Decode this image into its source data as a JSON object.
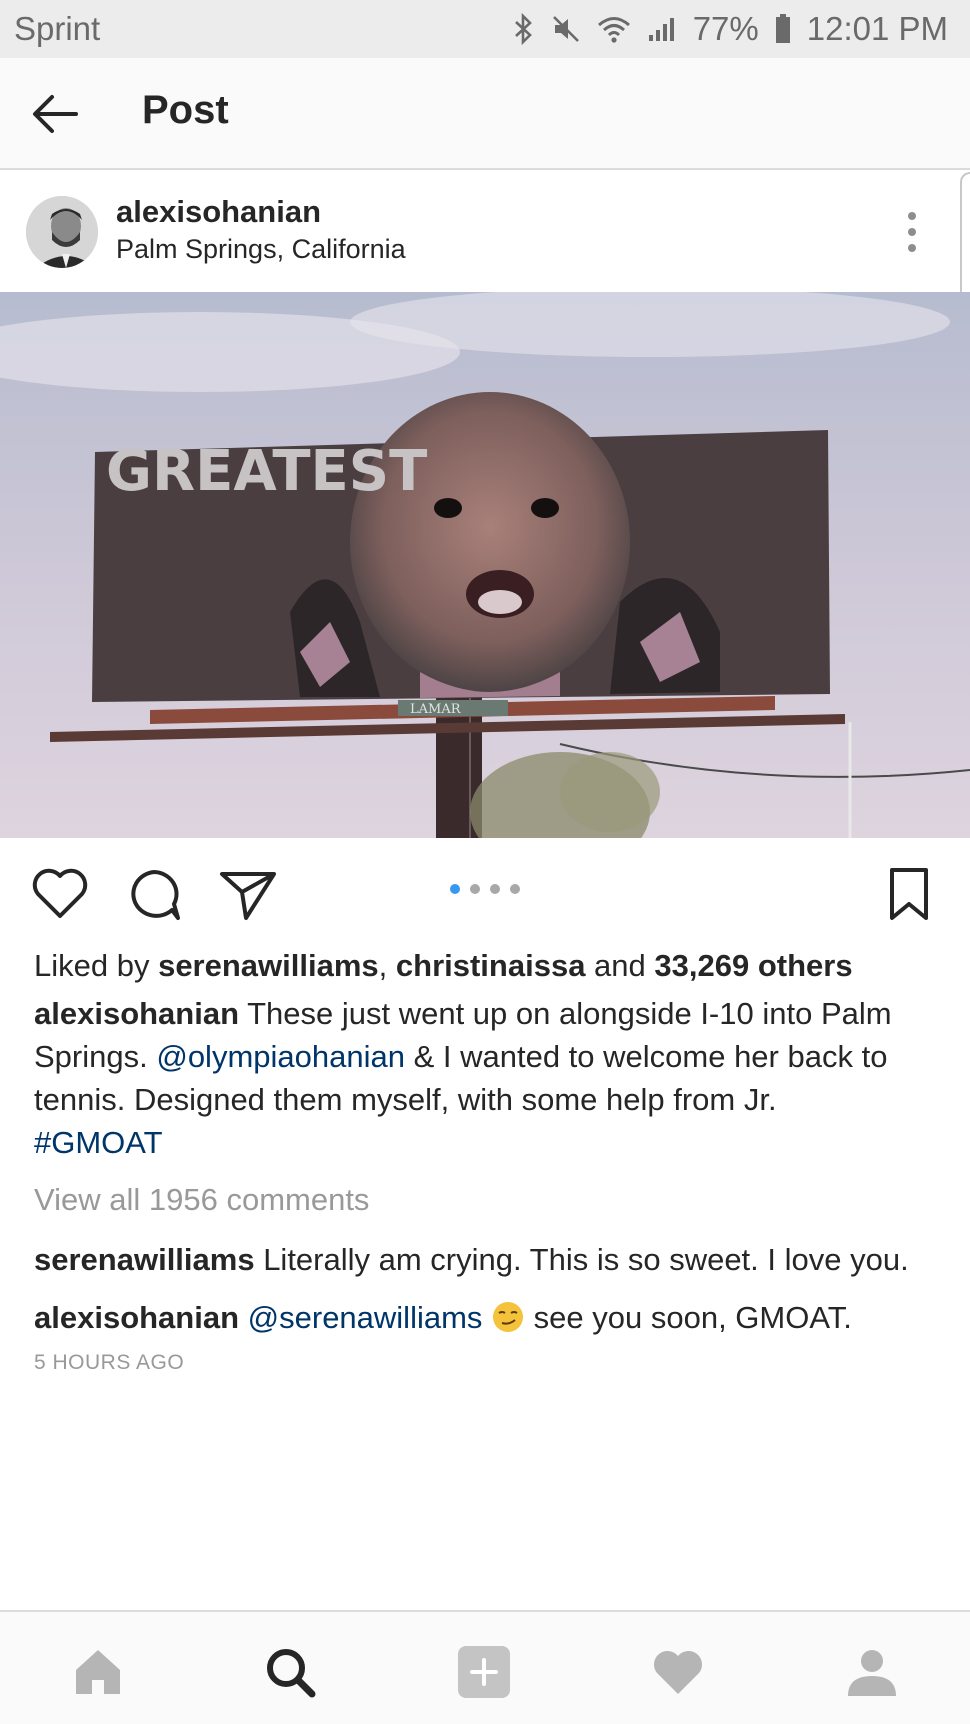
{
  "status_bar": {
    "carrier": "Sprint",
    "battery": "77%",
    "time": "12:01 PM"
  },
  "header": {
    "title": "Post"
  },
  "post": {
    "username": "alexisohanian",
    "location": "Palm Springs, California",
    "image": {
      "billboard_text": "GREATEST",
      "billboard_brand": "LAMAR"
    },
    "carousel": {
      "total": 4,
      "active_index": 0
    },
    "likes": {
      "prefix": "Liked by ",
      "user1": "serenawilliams",
      "sep": ", ",
      "user2": "christinaissa",
      "and": " and ",
      "others": "33,269 others"
    },
    "caption": {
      "author": "alexisohanian",
      "text1": " These just went up on alongside I-10 into Palm Springs. ",
      "mention": "@olympiaohanian",
      "text2": " & I wanted to welcome her back to tennis. Designed them myself, with some help from Jr.",
      "hashtag": "#GMOAT"
    },
    "view_all_comments": "View all 1956 comments",
    "comments": [
      {
        "author": "serenawilliams",
        "text": " Literally am crying. This is so sweet. I love you."
      },
      {
        "author": "alexisohanian",
        "mention": "@serenawilliams",
        "emoji": "smirking-face-emoji",
        "text": " see you soon, GMOAT."
      }
    ],
    "timestamp": "5 HOURS AGO"
  },
  "bottom_nav": {
    "items": [
      "home-icon",
      "search-icon",
      "add-post-icon",
      "activity-heart-icon",
      "profile-icon"
    ],
    "active": "search-icon"
  },
  "colors": {
    "link": "#003569",
    "carousel_active": "#3897f0",
    "muted": "#999999"
  }
}
